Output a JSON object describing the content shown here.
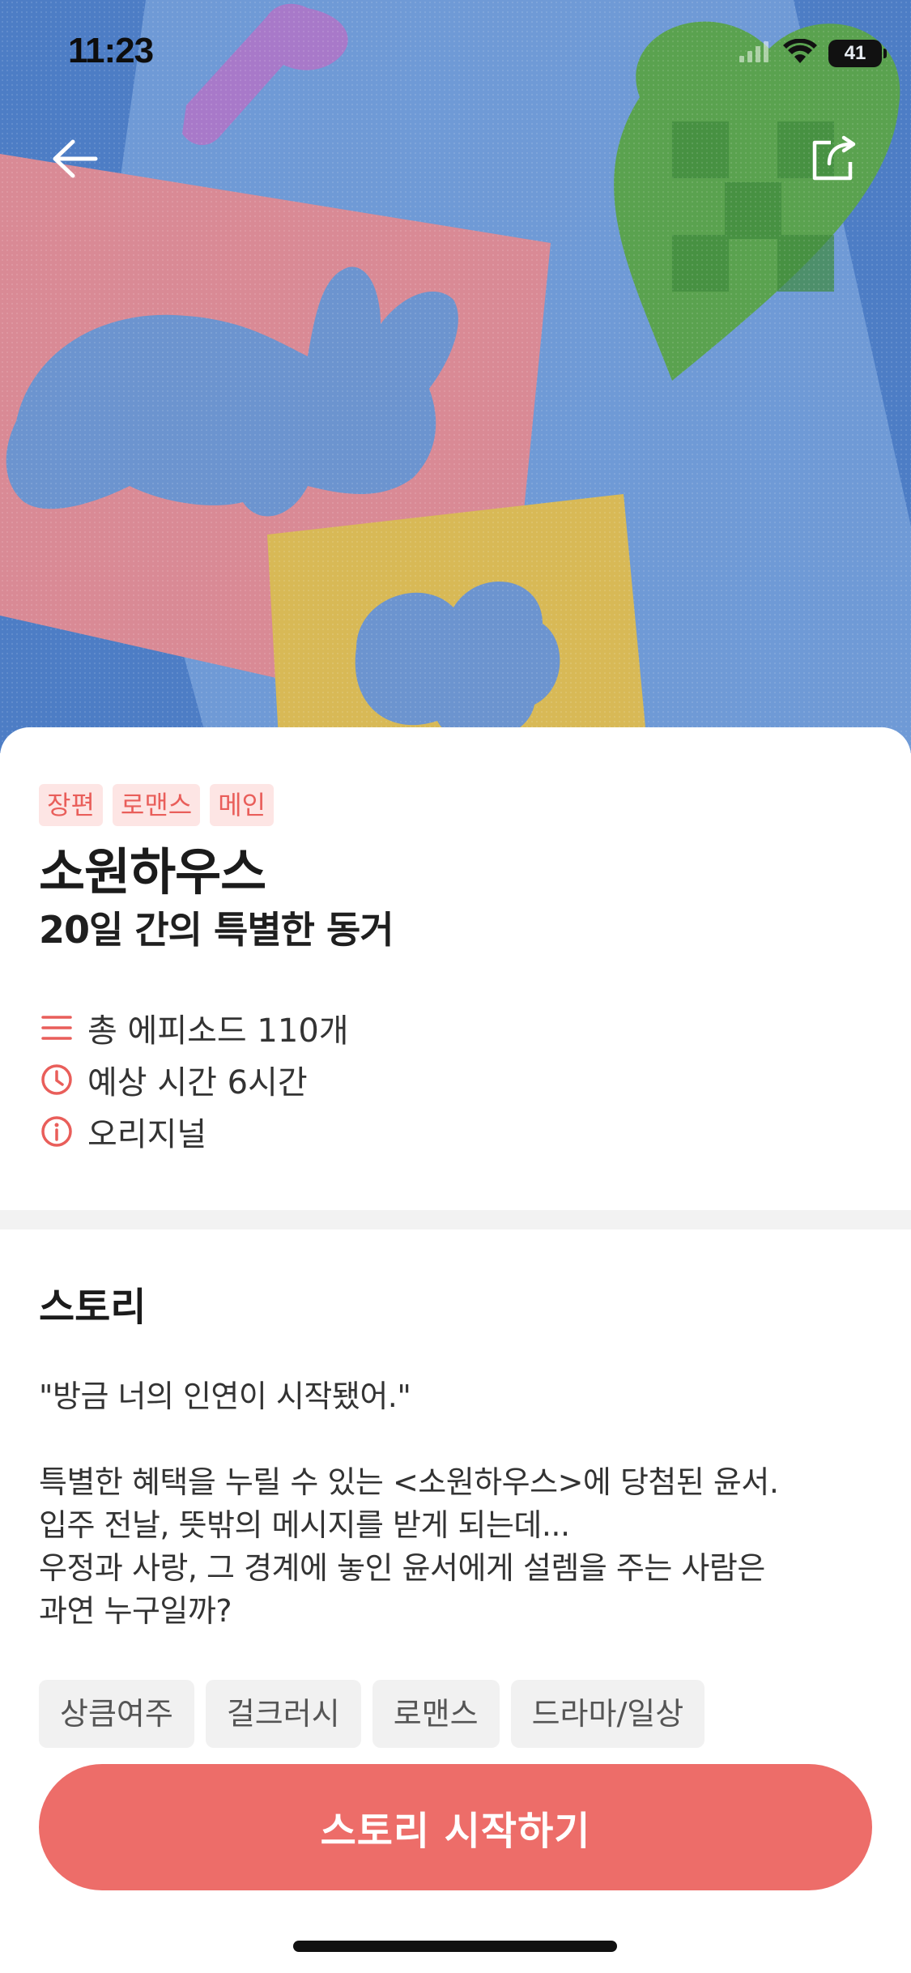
{
  "status_bar": {
    "time": "11:23",
    "battery": "41"
  },
  "nav": {
    "back_icon": "arrow-left-icon",
    "share_icon": "share-icon"
  },
  "work": {
    "badges": [
      "장편",
      "로맨스",
      "메인"
    ],
    "title": "소원하우스",
    "subtitle": "20일 간의 특별한 동거",
    "meta": {
      "episodes": "총 에피소드 110개",
      "time": "예상 시간 6시간",
      "type": "오리지널"
    }
  },
  "story": {
    "heading": "스토리",
    "quote": "\"방금 너의 인연이 시작됐어.\"",
    "lines": [
      "특별한 혜택을 누릴 수 있는 <소원하우스>에 당첨된 윤서.",
      "입주 전날, 뜻밖의 메시지를 받게 되는데...",
      "우정과 사랑, 그 경계에 놓인 윤서에게 설렘을 주는 사람은",
      "과연 누구일까?"
    ]
  },
  "tags": [
    "상큼여주",
    "걸크러시",
    "로맨스",
    "드라마/일상"
  ],
  "cta": {
    "label": "스토리 시작하기"
  },
  "colors": {
    "accent": "#ed6d69",
    "badge_bg": "#fde5e4",
    "badge_text": "#e95e5a"
  }
}
